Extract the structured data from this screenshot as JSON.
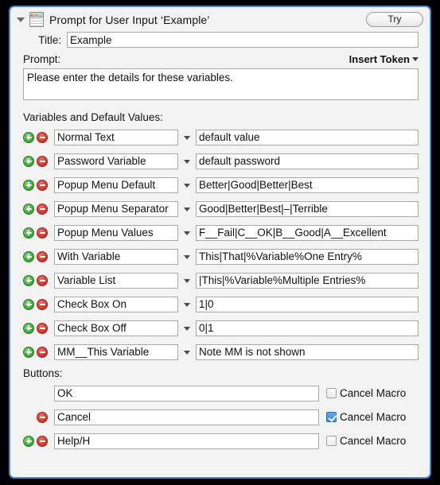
{
  "panel": {
    "title": "Prompt for User Input ‘Example’",
    "icon": "window-prompt-icon",
    "disclosure": "disclosure-triangle-open",
    "try_label": "Try",
    "accent_color": "#4a86d8",
    "background_color": "#f3f3f3"
  },
  "title_field": {
    "label": "Title:",
    "value": "Example",
    "placeholder": ""
  },
  "prompt_field": {
    "label": "Prompt:",
    "insert_token_label": "Insert Token",
    "value": "Please enter the details for these variables.",
    "placeholder": ""
  },
  "variables_section": {
    "label": "Variables and Default Values:",
    "add_icon": "plus-circle-icon",
    "remove_icon": "minus-circle-icon",
    "menu_icon": "chevron-down-icon",
    "rows": [
      {
        "name": "Normal Text",
        "value": "default value"
      },
      {
        "name": "Password Variable",
        "value": "default password"
      },
      {
        "name": "Popup Menu Default",
        "value": "Better|Good|Better|Best"
      },
      {
        "name": "Popup Menu Separator",
        "value": "Good|Better|Best|–|Terrible"
      },
      {
        "name": "Popup Menu Values",
        "value": "F__Fail|C__OK|B__Good|A__Excellent"
      },
      {
        "name": "With Variable",
        "value": "This|That|%Variable%One Entry%"
      },
      {
        "name": "Variable List",
        "value": "|This|%Variable%Multiple Entries%"
      },
      {
        "name": "Check Box On",
        "value": "1|0"
      },
      {
        "name": "Check Box Off",
        "value": "0|1"
      },
      {
        "name": "MM__This Variable",
        "value": "Note MM is not shown"
      }
    ]
  },
  "buttons_section": {
    "label": "Buttons:",
    "cancel_macro_label": "Cancel Macro",
    "rows": [
      {
        "name": "OK",
        "cancel_macro": false,
        "has_add": false,
        "has_remove": false
      },
      {
        "name": "Cancel",
        "cancel_macro": true,
        "has_add": false,
        "has_remove": true
      },
      {
        "name": "Help/H",
        "cancel_macro": false,
        "has_add": true,
        "has_remove": true
      }
    ]
  }
}
